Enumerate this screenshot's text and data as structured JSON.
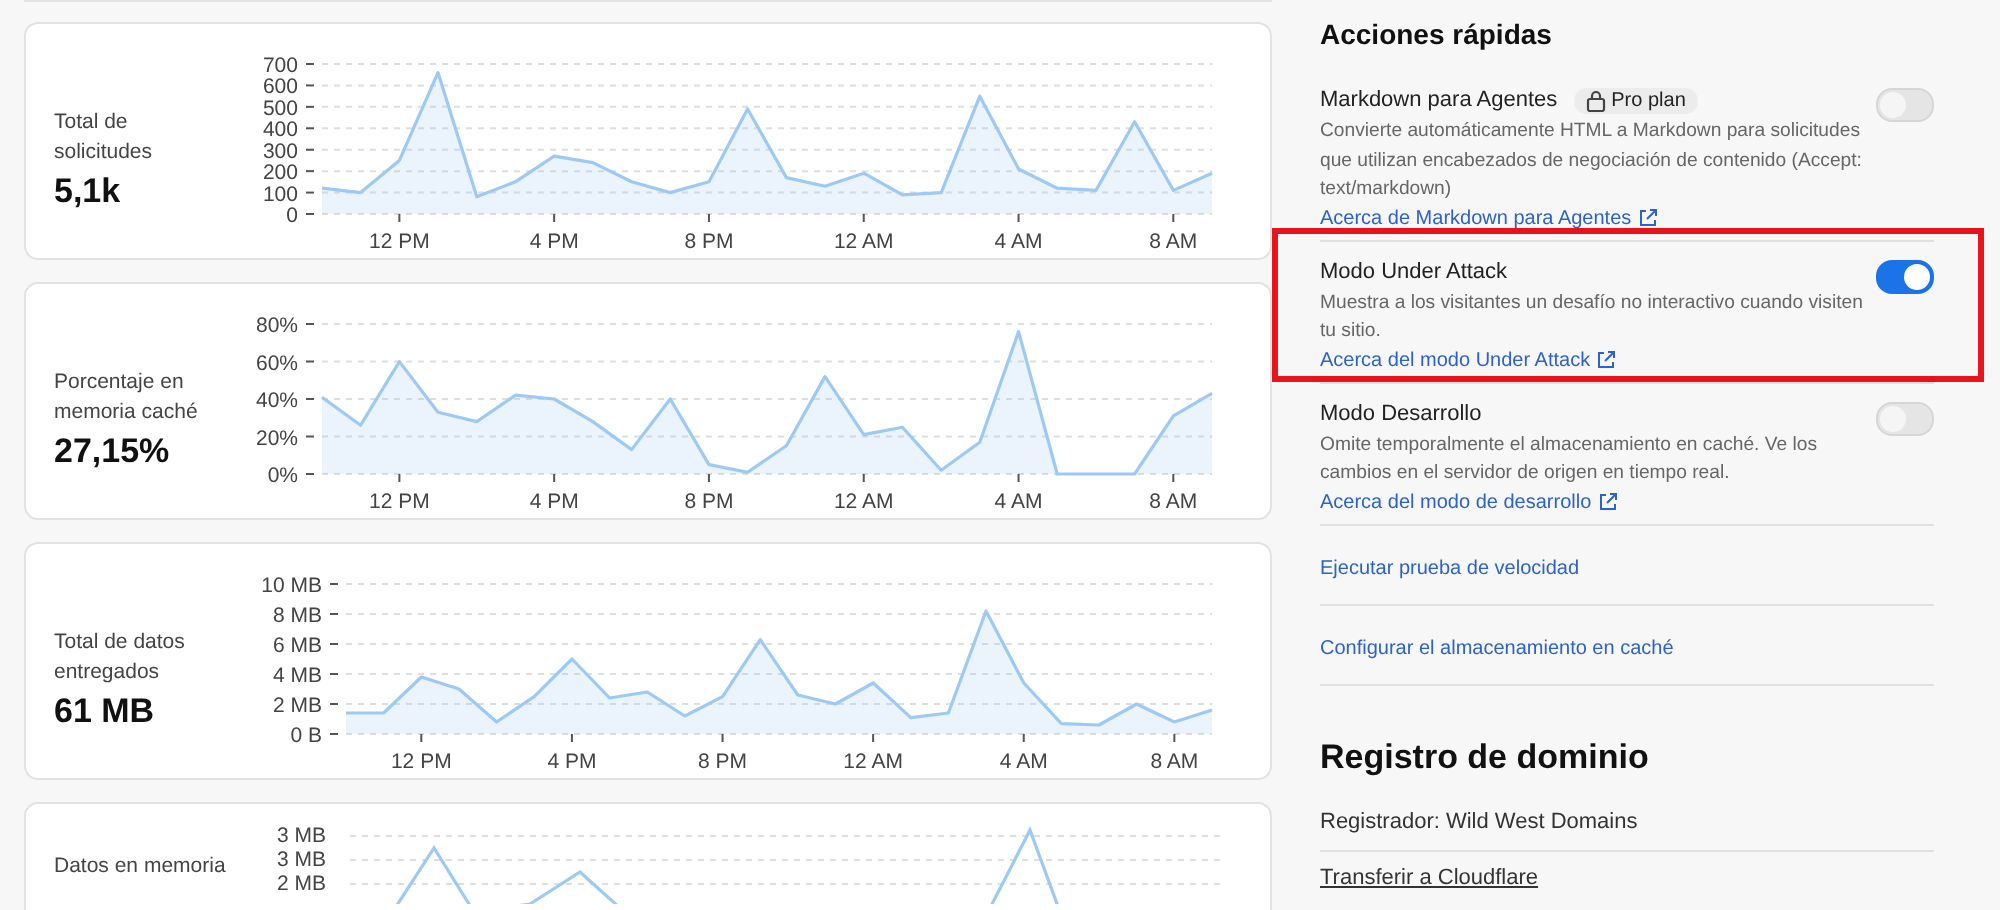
{
  "metrics": [
    {
      "title": "Total de solicitudes",
      "value": "5,1k",
      "chart_data": {
        "type": "area",
        "grid": true,
        "categories": [
          null,
          null,
          "12 PM",
          null,
          null,
          null,
          "4 PM",
          null,
          null,
          null,
          "8 PM",
          null,
          null,
          null,
          "12 AM",
          null,
          null,
          null,
          "4 AM",
          null,
          null,
          null,
          "8 AM",
          null
        ],
        "ylim": [
          0,
          700
        ],
        "yticks": [
          0,
          100,
          200,
          300,
          400,
          500,
          600,
          700
        ],
        "series": [
          {
            "color": "#9ccaf5",
            "values": [
              120,
              100,
              250,
              660,
              80,
              150,
              270,
              240,
              150,
              100,
              150,
              490,
              170,
              130,
              190,
              90,
              100,
              550,
              210,
              120,
              110,
              430,
              110,
              190
            ]
          }
        ]
      }
    },
    {
      "title": "Porcentaje en memoria caché",
      "value": "27,15%",
      "chart_data": {
        "type": "area",
        "grid": true,
        "categories": [
          null,
          null,
          "12 PM",
          null,
          null,
          null,
          "4 PM",
          null,
          null,
          null,
          "8 PM",
          null,
          null,
          null,
          "12 AM",
          null,
          null,
          null,
          "4 AM",
          null,
          null,
          null,
          "8 AM",
          null
        ],
        "ylim": [
          0,
          80
        ],
        "yticks": [
          {
            "value": 0,
            "label": "0%"
          },
          {
            "value": 20,
            "label": "20%"
          },
          {
            "value": 40,
            "label": "40%"
          },
          {
            "value": 60,
            "label": "60%"
          },
          {
            "value": 80,
            "label": "80%"
          }
        ],
        "series": [
          {
            "color": "#9ccaf5",
            "values": [
              41,
              26,
              60,
              33,
              28,
              42,
              40,
              28,
              13,
              40,
              5,
              1,
              15,
              52,
              21,
              25,
              2,
              17,
              76,
              0,
              0,
              0,
              31,
              43
            ]
          }
        ]
      }
    },
    {
      "title": "Total de datos entregados",
      "value": "61 MB",
      "chart_data": {
        "type": "area",
        "grid": true,
        "categories": [
          null,
          null,
          "12 PM",
          null,
          null,
          null,
          "4 PM",
          null,
          null,
          null,
          "8 PM",
          null,
          null,
          null,
          "12 AM",
          null,
          null,
          null,
          "4 AM",
          null,
          null,
          null,
          "8 AM",
          null
        ],
        "ylim": [
          0,
          10
        ],
        "yticks": [
          {
            "value": 0,
            "label": "0 B"
          },
          {
            "value": 2,
            "label": "2 MB"
          },
          {
            "value": 4,
            "label": "4 MB"
          },
          {
            "value": 6,
            "label": "6 MB"
          },
          {
            "value": 8,
            "label": "8 MB"
          },
          {
            "value": 10,
            "label": "10 MB"
          }
        ],
        "series": [
          {
            "color": "#9ccaf5",
            "values": [
              1.4,
              1.4,
              3.8,
              3,
              0.8,
              2.5,
              5,
              2.4,
              2.8,
              1.2,
              2.5,
              6.3,
              2.6,
              2,
              3.4,
              1.1,
              1.4,
              8.2,
              3.4,
              0.7,
              0.6,
              2,
              0.8,
              1.6
            ]
          }
        ]
      }
    },
    {
      "title": "Datos en memoria",
      "y_tick_labels": [
        "3 MB",
        "3 MB",
        "2 MB"
      ]
    }
  ],
  "quick_actions": {
    "title": "Acciones rápidas",
    "items": [
      {
        "title": "Markdown para Agentes",
        "badge": "Pro plan",
        "on": false,
        "highlighted": false,
        "description": "Convierte automáticamente HTML a Markdown para solicitudes que utilizan encabezados de negociación de contenido (Accept: text/markdown)",
        "link": "Acerca de Markdown para Agentes"
      },
      {
        "title": "Modo Under Attack",
        "on": true,
        "highlighted": true,
        "description": "Muestra a los visitantes un desafío no interactivo cuando visiten tu sitio.",
        "link": "Acerca del modo Under Attack"
      },
      {
        "title": "Modo Desarrollo",
        "on": false,
        "highlighted": false,
        "description": "Omite temporalmente el almacenamiento en caché. Ve los cambios en el servidor de origen en tiempo real.",
        "link": "Acerca del modo de desarrollo"
      }
    ],
    "links": [
      "Ejecutar prueba de velocidad",
      "Configurar el almacenamiento en caché"
    ]
  },
  "domain_registration": {
    "title": "Registro de dominio",
    "registrar": "Registrador: Wild West Domains",
    "transfer_link": "Transferir a Cloudflare"
  }
}
